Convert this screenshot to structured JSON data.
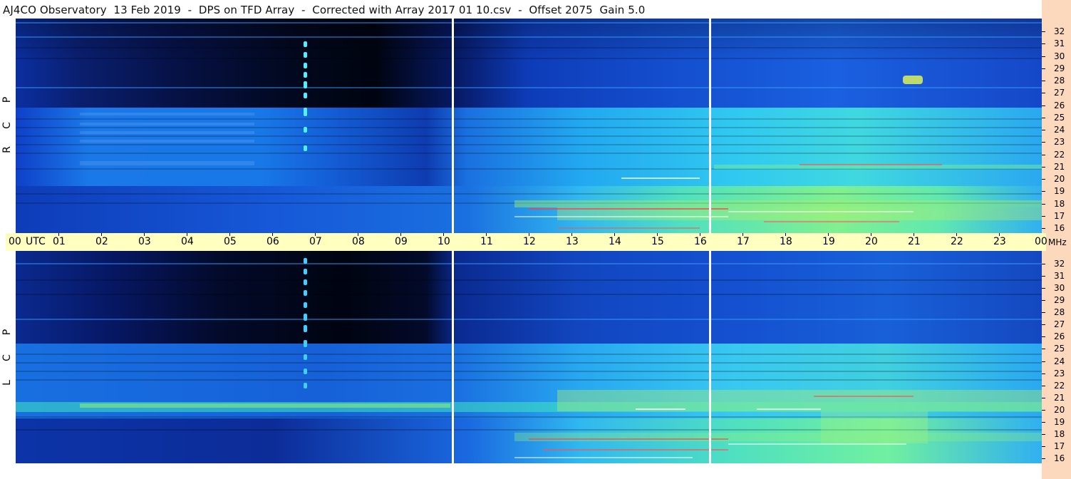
{
  "title": "AJ4CO Observatory  13 Feb 2019  -  DPS on TFD Array  -  Corrected with Array 2017 01 10.csv  -  Offset 2075  Gain 5.0",
  "panels": {
    "top": {
      "polarization_letters": [
        "R",
        "C",
        "P"
      ]
    },
    "bottom": {
      "polarization_letters": [
        "L",
        "C",
        "P"
      ]
    }
  },
  "frequency_axis": {
    "labels": [
      "32",
      "31",
      "30",
      "29",
      "28",
      "27",
      "26",
      "25",
      "24",
      "23",
      "22",
      "21",
      "20",
      "19",
      "18",
      "17",
      "16"
    ]
  },
  "utc_axis": {
    "start_label": "00",
    "utc_label": "UTC",
    "hours": [
      "01",
      "02",
      "03",
      "04",
      "05",
      "06",
      "07",
      "08",
      "09",
      "10",
      "11",
      "12",
      "13",
      "14",
      "15",
      "16",
      "17",
      "18",
      "19",
      "20",
      "21",
      "22",
      "23"
    ],
    "end_label": "00",
    "unit_label": "MHz"
  },
  "colors": {
    "background": "#ffffff",
    "utc_bar": "#ffffc0",
    "freq_strip": "#fcd9bd",
    "spectrum_dark": "#000818",
    "spectrum_low": "#0a2a9a",
    "spectrum_mid": "#1a6ae8",
    "spectrum_high": "#30c8f0",
    "spectrum_hot": "#e8f040"
  }
}
